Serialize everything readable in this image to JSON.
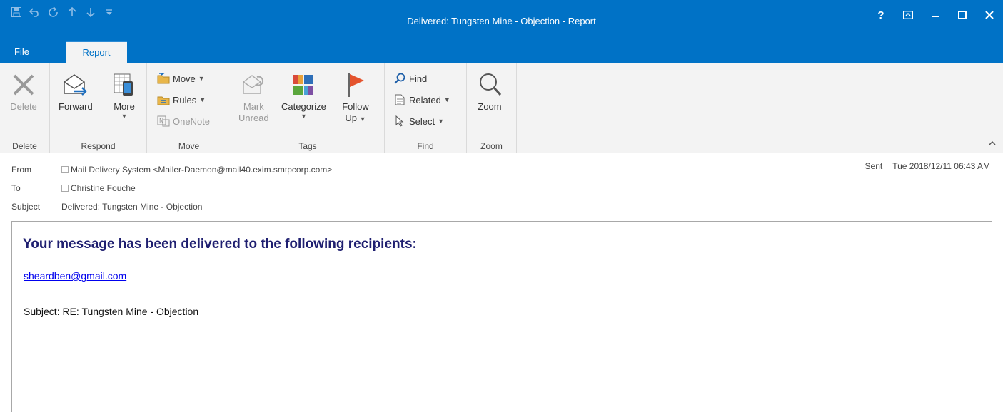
{
  "window": {
    "title": "Delivered: Tungsten Mine - Objection - Report",
    "controls": [
      "?",
      "⧉",
      "–",
      "☐",
      "✕"
    ]
  },
  "qat": [
    "save-icon",
    "undo-icon",
    "redo-icon",
    "up-icon",
    "down-icon",
    "customize-icon"
  ],
  "tabs": {
    "file": "File",
    "report": "Report"
  },
  "ribbon": {
    "delete": {
      "button": "Delete",
      "group": "Delete"
    },
    "respond": {
      "forward": "Forward",
      "more": "More",
      "group": "Respond"
    },
    "move": {
      "move": "Move",
      "rules": "Rules",
      "onenote": "OneNote",
      "group": "Move"
    },
    "tags": {
      "mark": "Mark",
      "unread": "Unread",
      "categorize": "Categorize",
      "follow": "Follow",
      "up": "Up",
      "group": "Tags"
    },
    "find": {
      "find": "Find",
      "related": "Related",
      "select": "Select",
      "group": "Find"
    },
    "zoom": {
      "zoom": "Zoom",
      "group": "Zoom"
    }
  },
  "header": {
    "from_label": "From",
    "from_value": "Mail Delivery System <Mailer-Daemon@mail40.exim.smtpcorp.com>",
    "to_label": "To",
    "to_value": "Christine Fouche",
    "subject_label": "Subject",
    "subject_value": "Delivered: Tungsten Mine - Objection",
    "sent_label": "Sent",
    "sent_value": "Tue 2018/12/11 06:43 AM"
  },
  "body": {
    "headline": "Your message has been delivered to the following recipients:",
    "recipient": "sheardben@gmail.com",
    "subject_line": "Subject: RE: Tungsten Mine - Objection"
  }
}
